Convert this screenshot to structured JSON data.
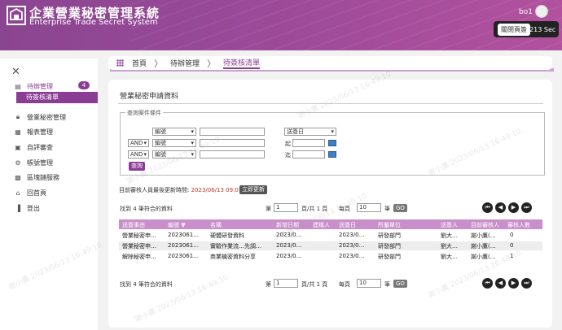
{
  "header": {
    "title": "企業營業秘密管理系統",
    "subtitle": "Enterprise Trade Secret System",
    "user": "bo1",
    "logout_label": "關閉頁簽",
    "session": "1213 Sec"
  },
  "sidebar": {
    "close": "✕",
    "items": [
      {
        "label": "待辦管理",
        "badge": "4",
        "icon": "inbox-icon"
      },
      {
        "label": "營業秘密管理",
        "icon": "lock-icon"
      },
      {
        "label": "報表管理",
        "icon": "report-icon"
      },
      {
        "label": "自評審查",
        "icon": "review-icon"
      },
      {
        "label": "帳號管理",
        "icon": "gear-icon"
      },
      {
        "label": "區塊鏈服務",
        "icon": "blockchain-icon"
      },
      {
        "label": "回首頁",
        "icon": "home-icon"
      },
      {
        "label": "登出",
        "icon": "logout-icon"
      }
    ],
    "sub_item": "待簽核清單"
  },
  "breadcrumb": {
    "home": "首頁",
    "level1": "待辦管理",
    "current": "待簽核清單"
  },
  "main": {
    "title": "營業秘密申請資料",
    "legend": "查詢案件條件",
    "row1_field": "編號",
    "row2_op": "AND",
    "row2_field": "編號",
    "row3_op": "AND",
    "row3_field": "編號",
    "date_field": "送簽日",
    "from_label": "起",
    "to_label": "迄",
    "query_btn": "查詢",
    "last_update_label": "目前審核人員最後更新時間:",
    "last_update_time": "2023/06/13 09:07:27",
    "refresh_btn": "立即更新"
  },
  "pager_top": {
    "found": "找到 4 筆符合的資料",
    "page_prefix": "第",
    "page_value": "1",
    "page_suffix": "頁/共 1 頁",
    "per_prefix": "每頁",
    "per_value": "10",
    "per_suffix": "筆",
    "go": "GO"
  },
  "pager_bottom": {
    "found": "找到 4 筆符合的資料",
    "page_prefix": "第",
    "page_value": "1",
    "page_suffix": "頁/共 1 頁",
    "per_prefix": "每頁",
    "per_value": "10",
    "per_suffix": "筆",
    "go": "GO"
  },
  "table": {
    "headers": [
      "送簽事由",
      "編號 ▼",
      "名稱",
      "新增日期",
      "建檔人",
      "送簽日",
      "所屬單位",
      "送簽人",
      "目前審核人",
      "審核人數"
    ],
    "rows": [
      [
        "營業秘密申…",
        "2023061…",
        "硬體研發資料",
        "2023/0…",
        "",
        "2023/0…",
        "研發部門",
        "劉大…",
        "謝小鷹(…",
        "0"
      ],
      [
        "營業秘密申…",
        "2023061…",
        "實驗作業流…先調…",
        "2023/0…",
        "",
        "2023/0…",
        "研發部門",
        "劉大…",
        "謝小鷹(…",
        "0"
      ],
      [
        "解除秘密申…",
        "2023061…",
        "商業機密資料分享",
        "2023/0…",
        "",
        "2023/0…",
        "研發部門",
        "劉大…",
        "謝小鷹(…",
        "1"
      ]
    ]
  },
  "watermark": "謝小鷹 2023/06/13 16:49:10"
}
